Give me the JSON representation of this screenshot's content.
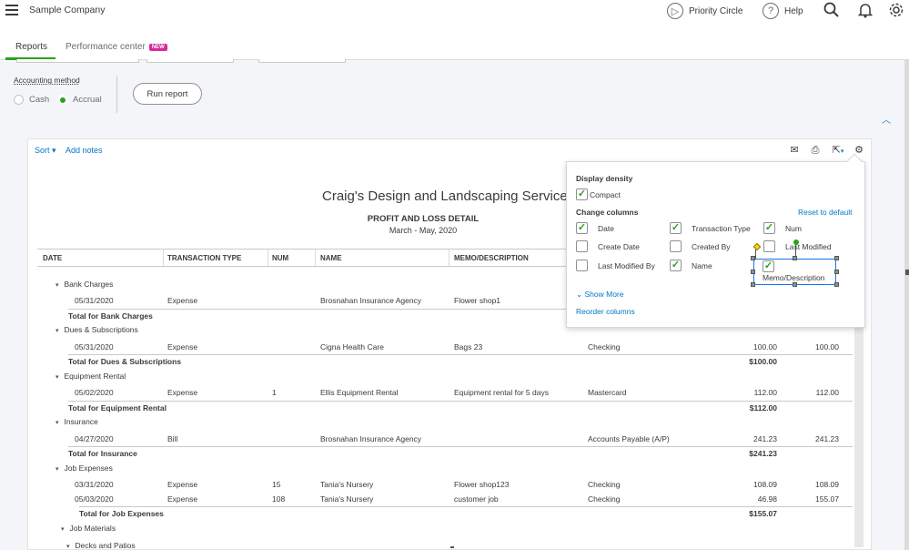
{
  "app": {
    "company": "Sample Company",
    "priority_circle": "Priority Circle",
    "help": "Help"
  },
  "tabs": [
    {
      "label": "Reports"
    },
    {
      "label": "Performance center",
      "badge": "NEW"
    }
  ],
  "options": {
    "accounting_method_label": "Accounting method",
    "cash_label": "Cash",
    "accrual_label": "Accrual",
    "selected": "Accrual",
    "run_report": "Run report"
  },
  "toolbar": {
    "sort": "Sort",
    "add_notes": "Add notes"
  },
  "report": {
    "company_title": "Craig's Design and Landscaping Services",
    "report_name": "PROFIT AND LOSS DETAIL",
    "date_range": "March - May, 2020",
    "columns": [
      "DATE",
      "TRANSACTION TYPE",
      "NUM",
      "NAME",
      "MEMO/DESCRIPTION"
    ],
    "rows": [
      {
        "kind": "group",
        "label": "Bank Charges"
      },
      {
        "kind": "line",
        "date": "05/31/2020",
        "type": "Expense",
        "num": "",
        "name": "Brosnahan Insurance Agency",
        "memo": "Flower shop1",
        "split": "",
        "amount": "",
        "balance": ""
      },
      {
        "kind": "total",
        "label": "Total for Bank Charges",
        "amount": ""
      },
      {
        "kind": "group",
        "label": "Dues & Subscriptions"
      },
      {
        "kind": "line",
        "date": "05/31/2020",
        "type": "Expense",
        "num": "",
        "name": "Cigna Health Care",
        "memo": "Bags 23",
        "split": "Checking",
        "amount": "100.00",
        "balance": "100.00"
      },
      {
        "kind": "total",
        "label": "Total for Dues & Subscriptions",
        "amount": "$100.00"
      },
      {
        "kind": "group",
        "label": "Equipment Rental"
      },
      {
        "kind": "line",
        "date": "05/02/2020",
        "type": "Expense",
        "num": "1",
        "name": "Ellis Equipment Rental",
        "memo": "Equipment rental for 5 days",
        "split": "Mastercard",
        "amount": "112.00",
        "balance": "112.00"
      },
      {
        "kind": "total",
        "label": "Total for Equipment Rental",
        "amount": "$112.00"
      },
      {
        "kind": "group",
        "label": "Insurance"
      },
      {
        "kind": "line",
        "date": "04/27/2020",
        "type": "Bill",
        "num": "",
        "name": "Brosnahan Insurance Agency",
        "memo": "",
        "split": "Accounts Payable (A/P)",
        "amount": "241.23",
        "balance": "241.23"
      },
      {
        "kind": "total",
        "label": "Total for Insurance",
        "amount": "$241.23"
      },
      {
        "kind": "group",
        "label": "Job Expenses"
      },
      {
        "kind": "line",
        "date": "03/31/2020",
        "type": "Expense",
        "num": "15",
        "name": "Tania's Nursery",
        "memo": "Flower shop123",
        "split": "Checking",
        "amount": "108.09",
        "balance": "108.09"
      },
      {
        "kind": "line",
        "date": "05/03/2020",
        "type": "Expense",
        "num": "108",
        "name": "Tania's Nursery",
        "memo": "customer job",
        "split": "Checking",
        "amount": "46.98",
        "balance": "155.07"
      },
      {
        "kind": "total",
        "label": "Total for Job Expenses",
        "amount": "$155.07"
      },
      {
        "kind": "group",
        "label": "Job Materials"
      },
      {
        "kind": "group",
        "label": "Decks and Patios"
      }
    ]
  },
  "popup": {
    "display_density": "Display density",
    "compact": "Compact",
    "change_columns": "Change columns",
    "reset": "Reset to default",
    "checkboxes": [
      {
        "label": "Date",
        "checked": true
      },
      {
        "label": "Transaction Type",
        "checked": true
      },
      {
        "label": "Num",
        "checked": true
      },
      {
        "label": "Create Date",
        "checked": false
      },
      {
        "label": "Created By",
        "checked": false
      },
      {
        "label": "Last Modified",
        "checked": false
      },
      {
        "label": "Last Modified By",
        "checked": false
      },
      {
        "label": "Name",
        "checked": true
      },
      {
        "label": "Memo/Description",
        "checked": true
      }
    ],
    "show_more": "Show More",
    "reorder": "Reorder columns"
  },
  "colors": {
    "accent_green": "#2ca01c",
    "link_blue": "#0077c5",
    "badge_pink": "#d52b9a"
  }
}
